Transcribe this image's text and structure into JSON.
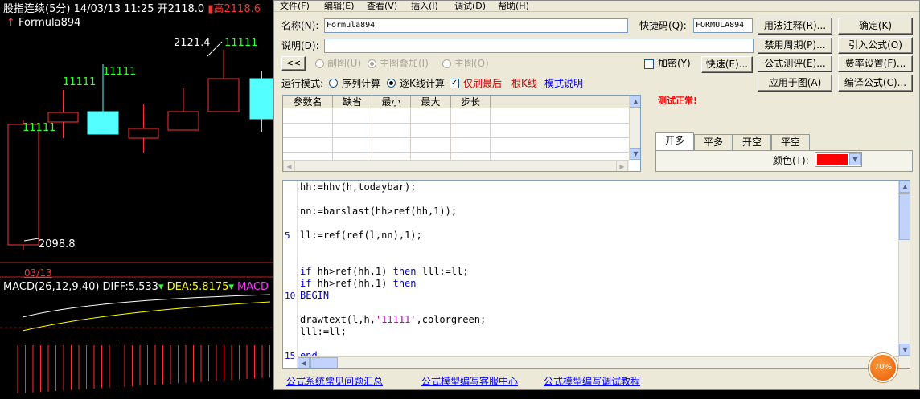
{
  "chart": {
    "header_name": "股指连续",
    "header_period": "(5分)",
    "header_date": "14/03/13",
    "header_time": "11:25",
    "header_open": "开2118.0",
    "header_high": "高2118.6",
    "formula_name": "Formula894",
    "price_2121": "2121.4",
    "price_2098": "2098.8",
    "label_11111": "11111",
    "date_label": "03/13",
    "macd_name": "MACD(26,12,9,40)",
    "macd_diff": "DIFF:5.533",
    "macd_dea": "DEA:5.8175",
    "macd_label": "MACD"
  },
  "colors": {
    "up": "#ff3333",
    "down": "#54ffff",
    "green_text": "#33ff33",
    "white_text": "#ffffff",
    "yellow_text": "#ffff00",
    "magenta_text": "#ff33ff"
  },
  "menu": [
    "文件(F)",
    "编辑(E)",
    "查看(V)",
    "插入(I)",
    "调试(D)",
    "帮助(H)"
  ],
  "form": {
    "name_label": "名称(N):",
    "name_value": "Formula894",
    "shortcut_label": "快捷码(Q):",
    "shortcut_value": "FORMULA894",
    "desc_label": "说明(D):",
    "desc_value": "",
    "collapse_btn": "<<",
    "sub_chart": "副图(U)",
    "main_overlay": "主图叠加(I)",
    "main_chart": "主图(O)",
    "encrypt": "加密(Y)",
    "quick_btn": "快速(E)..."
  },
  "buttons": {
    "usage_notes": "用法注释(R)...",
    "confirm": "确定(K)",
    "disable_period": "禁用周期(P)...",
    "import_formula": "引入公式(O)",
    "formula_test": "公式测评(E)...",
    "rate_settings": "费率设置(F)...",
    "apply_chart": "应用于图(A)",
    "compile_formula": "编译公式(C)..."
  },
  "run_mode": {
    "label": "运行模式:",
    "sequence": "序列计算",
    "bar_by_bar": "逐K线计算",
    "last_bar_only": "仅刷最后一根K线",
    "mode_desc_link": "模式说明"
  },
  "params_table": {
    "headers": [
      "参数名",
      "缺省",
      "最小",
      "最大",
      "步长"
    ]
  },
  "test_status": "测试正常!",
  "tabs": [
    "开多",
    "平多",
    "开空",
    "平空"
  ],
  "color_label": "颜色(T):",
  "color_value": "#ff0000",
  "code_lines": [
    {
      "n": "",
      "segs": [
        {
          "t": "hh:=hhv(h,todaybar);",
          "c": ""
        }
      ]
    },
    {
      "n": "",
      "segs": []
    },
    {
      "n": "",
      "segs": [
        {
          "t": "nn:=barslast(hh>ref(hh,1));",
          "c": ""
        }
      ]
    },
    {
      "n": "",
      "segs": []
    },
    {
      "n": "5",
      "segs": [
        {
          "t": "ll:=ref(ref(l,nn),1);",
          "c": ""
        }
      ]
    },
    {
      "n": "",
      "segs": []
    },
    {
      "n": "",
      "segs": []
    },
    {
      "n": "",
      "segs": [
        {
          "t": "if",
          "c": "kw"
        },
        {
          "t": " hh>ref(hh,1) ",
          "c": ""
        },
        {
          "t": "then",
          "c": "kw"
        },
        {
          "t": " lll:=ll;",
          "c": ""
        }
      ]
    },
    {
      "n": "",
      "segs": [
        {
          "t": "if",
          "c": "kw"
        },
        {
          "t": " hh>ref(hh,1) ",
          "c": ""
        },
        {
          "t": "then",
          "c": "kw"
        }
      ]
    },
    {
      "n": "10",
      "segs": [
        {
          "t": "BEGIN",
          "c": "kw"
        }
      ]
    },
    {
      "n": "",
      "segs": []
    },
    {
      "n": "",
      "segs": [
        {
          "t": "drawtext(l,h,",
          "c": ""
        },
        {
          "t": "'11111'",
          "c": "str"
        },
        {
          "t": ",colorgreen;",
          "c": ""
        }
      ]
    },
    {
      "n": "",
      "segs": [
        {
          "t": "lll:=ll;",
          "c": ""
        }
      ]
    },
    {
      "n": "",
      "segs": []
    },
    {
      "n": "15",
      "segs": [
        {
          "t": "end",
          "c": "kw"
        }
      ]
    }
  ],
  "links": {
    "faq": "公式系统常见问题汇总",
    "service": "公式模型编写客服中心",
    "tutorial": "公式模型编写调试教程"
  },
  "badge": "70%"
}
